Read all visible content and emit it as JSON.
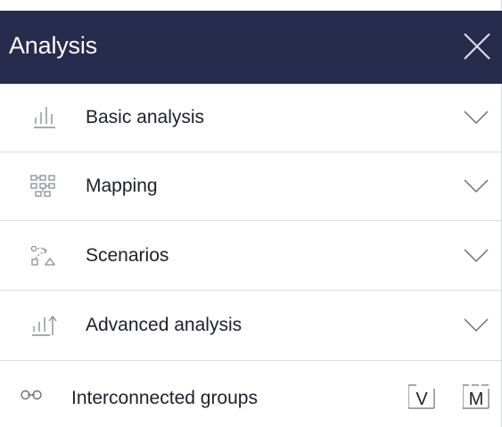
{
  "header": {
    "title": "Analysis",
    "close_icon": "close-icon"
  },
  "rows": [
    {
      "label": "Basic analysis",
      "icon": "bar-chart-icon",
      "expand_icon": "chevron-down-icon"
    },
    {
      "label": "Mapping",
      "icon": "grid-map-icon",
      "expand_icon": "chevron-down-icon"
    },
    {
      "label": "Scenarios",
      "icon": "scenario-path-icon",
      "expand_icon": "chevron-down-icon"
    },
    {
      "label": "Advanced analysis",
      "icon": "bar-chart-arrow-icon",
      "expand_icon": "chevron-down-icon"
    }
  ],
  "interconnected": {
    "label": "Interconnected groups",
    "icon": "link-icon",
    "v_button": "V",
    "m_button": "M"
  },
  "colors": {
    "header_bg": "#272b4c",
    "header_text": "#ffffff",
    "icon": "#8a8d99",
    "divider": "#dcdde3"
  }
}
